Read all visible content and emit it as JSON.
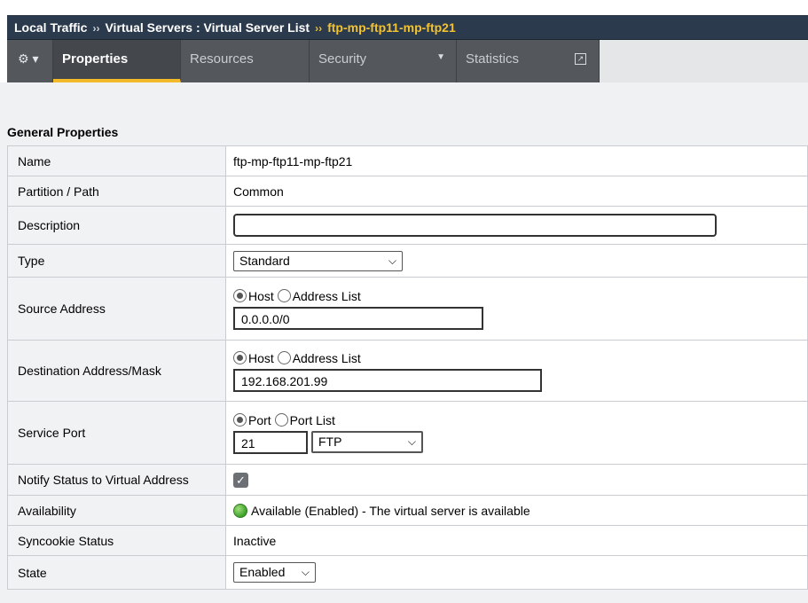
{
  "breadcrumb": {
    "items": [
      "Local Traffic",
      "Virtual Servers : Virtual Server List"
    ],
    "current": "ftp-mp-ftp11-mp-ftp21",
    "separator": "››"
  },
  "tabs": {
    "gear_caret": "▾",
    "items": [
      {
        "label": "Properties",
        "active": true
      },
      {
        "label": "Resources",
        "active": false
      },
      {
        "label": "Security",
        "active": false,
        "dropdown": true
      },
      {
        "label": "Statistics",
        "active": false,
        "external": true
      }
    ]
  },
  "section_title": "General Properties",
  "properties": {
    "name": {
      "label": "Name",
      "value": "ftp-mp-ftp11-mp-ftp21"
    },
    "partition": {
      "label": "Partition / Path",
      "value": "Common"
    },
    "description": {
      "label": "Description",
      "value": ""
    },
    "type": {
      "label": "Type",
      "value": "Standard"
    },
    "source": {
      "label": "Source Address",
      "radio_host": "Host",
      "radio_list": "Address List",
      "value": "0.0.0.0/0"
    },
    "destination": {
      "label": "Destination Address/Mask",
      "radio_host": "Host",
      "radio_list": "Address List",
      "value": "192.168.201.99"
    },
    "service_port": {
      "label": "Service Port",
      "radio_port": "Port",
      "radio_list": "Port List",
      "port": "21",
      "protocol": "FTP"
    },
    "notify": {
      "label": "Notify Status to Virtual Address",
      "checked": true
    },
    "availability": {
      "label": "Availability",
      "value": "Available (Enabled) - The virtual server is available",
      "status_color": "#3ea02a"
    },
    "syncookie": {
      "label": "Syncookie Status",
      "value": "Inactive"
    },
    "state": {
      "label": "State",
      "value": "Enabled"
    }
  },
  "colors": {
    "header_bg": "#2b3a4c",
    "accent": "#f2c230",
    "tab_bg": "#54575c"
  }
}
